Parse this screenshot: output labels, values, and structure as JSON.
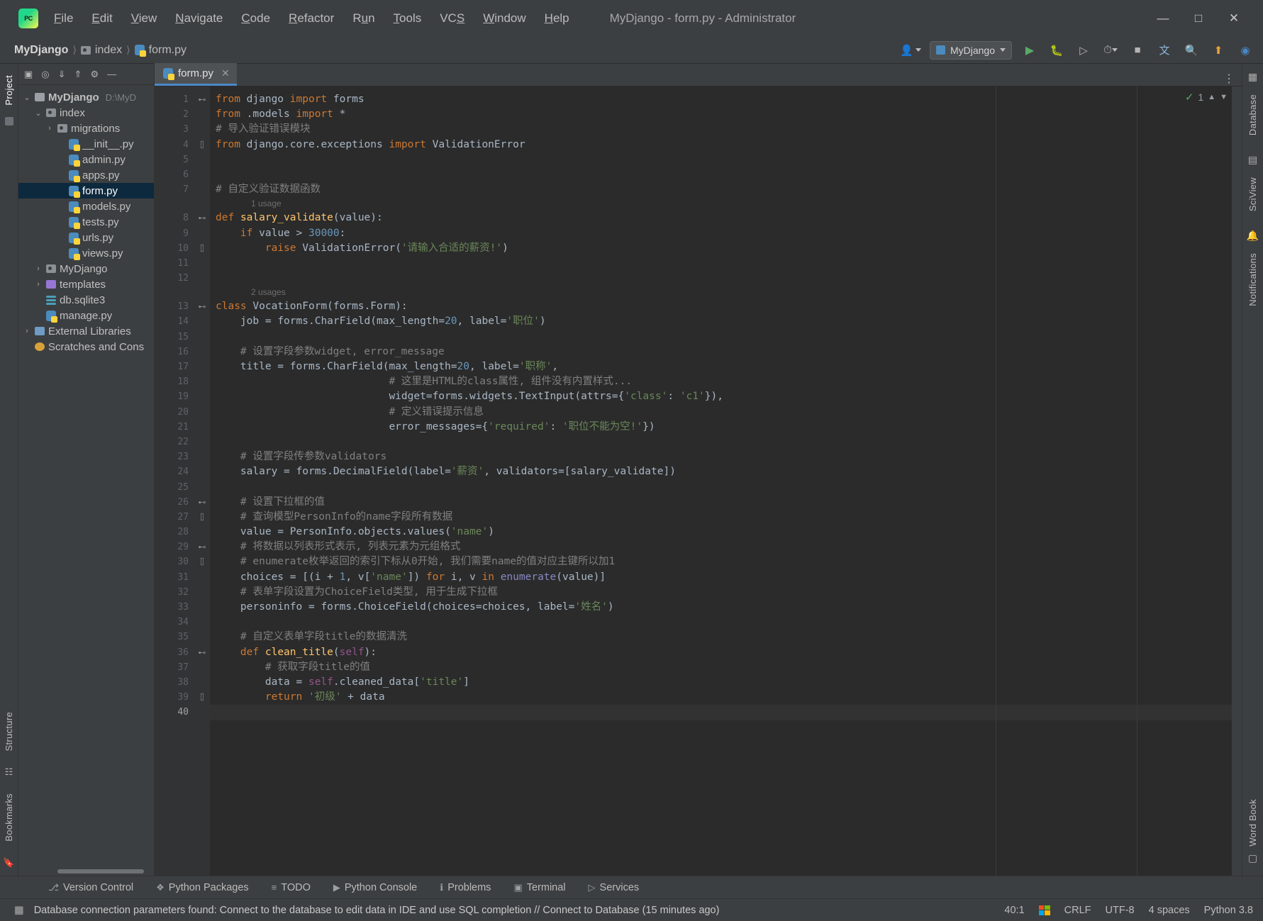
{
  "window": {
    "title": "MyDjango - form.py - Administrator",
    "app_logo": "pycharm-logo-icon",
    "controls": {
      "minimize": "—",
      "maximize": "□",
      "close": "✕"
    }
  },
  "menubar": [
    {
      "label": "File",
      "mnemonic": "F"
    },
    {
      "label": "Edit",
      "mnemonic": "E"
    },
    {
      "label": "View",
      "mnemonic": "V"
    },
    {
      "label": "Navigate",
      "mnemonic": "N"
    },
    {
      "label": "Code",
      "mnemonic": "C"
    },
    {
      "label": "Refactor",
      "mnemonic": "R"
    },
    {
      "label": "Run",
      "mnemonic": "u"
    },
    {
      "label": "Tools",
      "mnemonic": "T"
    },
    {
      "label": "VCS",
      "mnemonic": "S"
    },
    {
      "label": "Window",
      "mnemonic": "W"
    },
    {
      "label": "Help",
      "mnemonic": "H"
    }
  ],
  "breadcrumb": [
    {
      "label": "MyDjango",
      "icon": "project-icon"
    },
    {
      "label": "index",
      "icon": "folder-icon"
    },
    {
      "label": "form.py",
      "icon": "python-file-icon"
    }
  ],
  "toolbar": {
    "run_config": "MyDjango",
    "icons": [
      "account-icon",
      "run-icon",
      "debug-icon",
      "run-coverage-icon",
      "profile-icon",
      "stop-icon",
      "translate-icon",
      "search-icon",
      "updates-icon",
      "plugin-icon"
    ]
  },
  "left_strip": {
    "tabs": [
      "Project",
      "Bookmarks",
      "Structure"
    ]
  },
  "right_strip": {
    "tabs": [
      "Database",
      "SciView",
      "Notifications",
      "Word Book"
    ]
  },
  "project_panel": {
    "toolbar_icons": [
      "select-opened-file-icon",
      "locate-icon",
      "expand-all-icon",
      "collapse-all-icon",
      "settings-icon",
      "hide-icon"
    ],
    "tree": [
      {
        "depth": 0,
        "arrow": "⌄",
        "icon": "folder",
        "label": "MyDjango",
        "path": "D:\\MyD",
        "bold": true,
        "selected": false
      },
      {
        "depth": 1,
        "arrow": "⌄",
        "icon": "module",
        "label": "index",
        "path": "",
        "bold": false,
        "selected": false
      },
      {
        "depth": 2,
        "arrow": "›",
        "icon": "module",
        "label": "migrations",
        "path": "",
        "bold": false,
        "selected": false
      },
      {
        "depth": 3,
        "arrow": "",
        "icon": "python",
        "label": "__init__.py",
        "path": "",
        "bold": false,
        "selected": false
      },
      {
        "depth": 3,
        "arrow": "",
        "icon": "python",
        "label": "admin.py",
        "path": "",
        "bold": false,
        "selected": false
      },
      {
        "depth": 3,
        "arrow": "",
        "icon": "python",
        "label": "apps.py",
        "path": "",
        "bold": false,
        "selected": false
      },
      {
        "depth": 3,
        "arrow": "",
        "icon": "python",
        "label": "form.py",
        "path": "",
        "bold": false,
        "selected": true
      },
      {
        "depth": 3,
        "arrow": "",
        "icon": "python",
        "label": "models.py",
        "path": "",
        "bold": false,
        "selected": false
      },
      {
        "depth": 3,
        "arrow": "",
        "icon": "python",
        "label": "tests.py",
        "path": "",
        "bold": false,
        "selected": false
      },
      {
        "depth": 3,
        "arrow": "",
        "icon": "python",
        "label": "urls.py",
        "path": "",
        "bold": false,
        "selected": false
      },
      {
        "depth": 3,
        "arrow": "",
        "icon": "python",
        "label": "views.py",
        "path": "",
        "bold": false,
        "selected": false
      },
      {
        "depth": 1,
        "arrow": "›",
        "icon": "module",
        "label": "MyDjango",
        "path": "",
        "bold": false,
        "selected": false
      },
      {
        "depth": 1,
        "arrow": "›",
        "icon": "purple",
        "label": "templates",
        "path": "",
        "bold": false,
        "selected": false
      },
      {
        "depth": 1,
        "arrow": "",
        "icon": "db",
        "label": "db.sqlite3",
        "path": "",
        "bold": false,
        "selected": false
      },
      {
        "depth": 1,
        "arrow": "",
        "icon": "python",
        "label": "manage.py",
        "path": "",
        "bold": false,
        "selected": false
      },
      {
        "depth": 0,
        "arrow": "›",
        "icon": "lib",
        "label": "External Libraries",
        "path": "",
        "bold": false,
        "selected": false
      },
      {
        "depth": 0,
        "arrow": "",
        "icon": "scratch",
        "label": "Scratches and Cons",
        "path": "",
        "bold": false,
        "selected": false
      }
    ]
  },
  "editor": {
    "tabs": [
      {
        "label": "form.py",
        "icon": "python-file-icon",
        "active": true,
        "close": "✕"
      }
    ],
    "inspection": {
      "count": "1",
      "status_icon": "green-check"
    },
    "total_lines": 40,
    "current_line": 40,
    "lines": [
      {
        "n": 1,
        "fold": "⊷",
        "usage": ""
      },
      {
        "n": 2,
        "fold": "",
        "usage": ""
      },
      {
        "n": 3,
        "fold": "",
        "usage": ""
      },
      {
        "n": 4,
        "fold": "⌷",
        "usage": ""
      },
      {
        "n": 5,
        "fold": "",
        "usage": ""
      },
      {
        "n": 6,
        "fold": "",
        "usage": ""
      },
      {
        "n": 7,
        "fold": "",
        "usage": ""
      },
      {
        "n": 8,
        "fold": "⊷",
        "usage": "1 usage"
      },
      {
        "n": 9,
        "fold": "",
        "usage": ""
      },
      {
        "n": 10,
        "fold": "⌷",
        "usage": ""
      },
      {
        "n": 11,
        "fold": "",
        "usage": ""
      },
      {
        "n": 12,
        "fold": "",
        "usage": ""
      },
      {
        "n": 13,
        "fold": "⊷",
        "usage": "2 usages"
      },
      {
        "n": 14,
        "fold": "",
        "usage": ""
      },
      {
        "n": 15,
        "fold": "",
        "usage": ""
      },
      {
        "n": 16,
        "fold": "",
        "usage": ""
      },
      {
        "n": 17,
        "fold": "",
        "usage": ""
      },
      {
        "n": 18,
        "fold": "",
        "usage": ""
      },
      {
        "n": 19,
        "fold": "",
        "usage": ""
      },
      {
        "n": 20,
        "fold": "",
        "usage": ""
      },
      {
        "n": 21,
        "fold": "",
        "usage": ""
      },
      {
        "n": 22,
        "fold": "",
        "usage": ""
      },
      {
        "n": 23,
        "fold": "",
        "usage": ""
      },
      {
        "n": 24,
        "fold": "",
        "usage": ""
      },
      {
        "n": 25,
        "fold": "",
        "usage": ""
      },
      {
        "n": 26,
        "fold": "⊷",
        "usage": ""
      },
      {
        "n": 27,
        "fold": "⌷",
        "usage": ""
      },
      {
        "n": 28,
        "fold": "",
        "usage": ""
      },
      {
        "n": 29,
        "fold": "⊷",
        "usage": ""
      },
      {
        "n": 30,
        "fold": "⌷",
        "usage": ""
      },
      {
        "n": 31,
        "fold": "",
        "usage": ""
      },
      {
        "n": 32,
        "fold": "",
        "usage": ""
      },
      {
        "n": 33,
        "fold": "",
        "usage": ""
      },
      {
        "n": 34,
        "fold": "",
        "usage": ""
      },
      {
        "n": 35,
        "fold": "",
        "usage": ""
      },
      {
        "n": 36,
        "fold": "⊷",
        "usage": ""
      },
      {
        "n": 37,
        "fold": "",
        "usage": ""
      },
      {
        "n": 38,
        "fold": "",
        "usage": ""
      },
      {
        "n": 39,
        "fold": "⌷",
        "usage": ""
      },
      {
        "n": 40,
        "fold": "",
        "usage": ""
      }
    ],
    "code_text": [
      "from django import forms",
      "from .models import *",
      "# 导入验证错误模块",
      "from django.core.exceptions import ValidationError",
      "",
      "",
      "# 自定义验证数据函数",
      "def salary_validate(value):",
      "    if value > 30000:",
      "        raise ValidationError('请输入合适的薪资!')",
      "",
      "",
      "class VocationForm(forms.Form):",
      "    job = forms.CharField(max_length=20, label='职位')",
      "",
      "    # 设置字段参数widget, error_message",
      "    title = forms.CharField(max_length=20, label='职称',",
      "                            # 这里是HTML的class属性, 组件没有内置样式...",
      "                            widget=forms.widgets.TextInput(attrs={'class': 'c1'}),",
      "                            # 定义错误提示信息",
      "                            error_messages={'required': '职位不能为空!'})",
      "",
      "    # 设置字段传参数validators",
      "    salary = forms.DecimalField(label='薪资', validators=[salary_validate])",
      "",
      "    # 设置下拉框的值",
      "    # 查询模型PersonInfo的name字段所有数据",
      "    value = PersonInfo.objects.values('name')",
      "    # 将数据以列表形式表示, 列表元素为元组格式",
      "    # enumerate枚举返回的索引下标从0开始, 我们需要name的值对应主键所以加1",
      "    choices = [(i + 1, v['name']) for i, v in enumerate(value)]",
      "    # 表单字段设置为ChoiceField类型, 用于生成下拉框",
      "    personinfo = forms.ChoiceField(choices=choices, label='姓名')",
      "",
      "    # 自定义表单字段title的数据清洗",
      "    def clean_title(self):",
      "        # 获取字段title的值",
      "        data = self.cleaned_data['title']",
      "        return '初级' + data",
      ""
    ]
  },
  "bottom_bar": [
    {
      "label": "Version Control",
      "icon": "branch-icon"
    },
    {
      "label": "Python Packages",
      "icon": "package-icon"
    },
    {
      "label": "TODO",
      "icon": "todo-icon"
    },
    {
      "label": "Python Console",
      "icon": "console-icon"
    },
    {
      "label": "Problems",
      "icon": "problems-icon"
    },
    {
      "label": "Terminal",
      "icon": "terminal-icon"
    },
    {
      "label": "Services",
      "icon": "services-icon"
    }
  ],
  "status_bar": {
    "db_icon": "database-icon",
    "message": "Database connection parameters found: Connect to the database to edit data in IDE and use SQL completion // Connect to Database (15 minutes ago)",
    "caret": "40:1",
    "os_icon": "windows-logo-icon",
    "line_sep": "CRLF",
    "encoding": "UTF-8",
    "indent": "4 spaces",
    "interpreter": "Python 3.8"
  }
}
